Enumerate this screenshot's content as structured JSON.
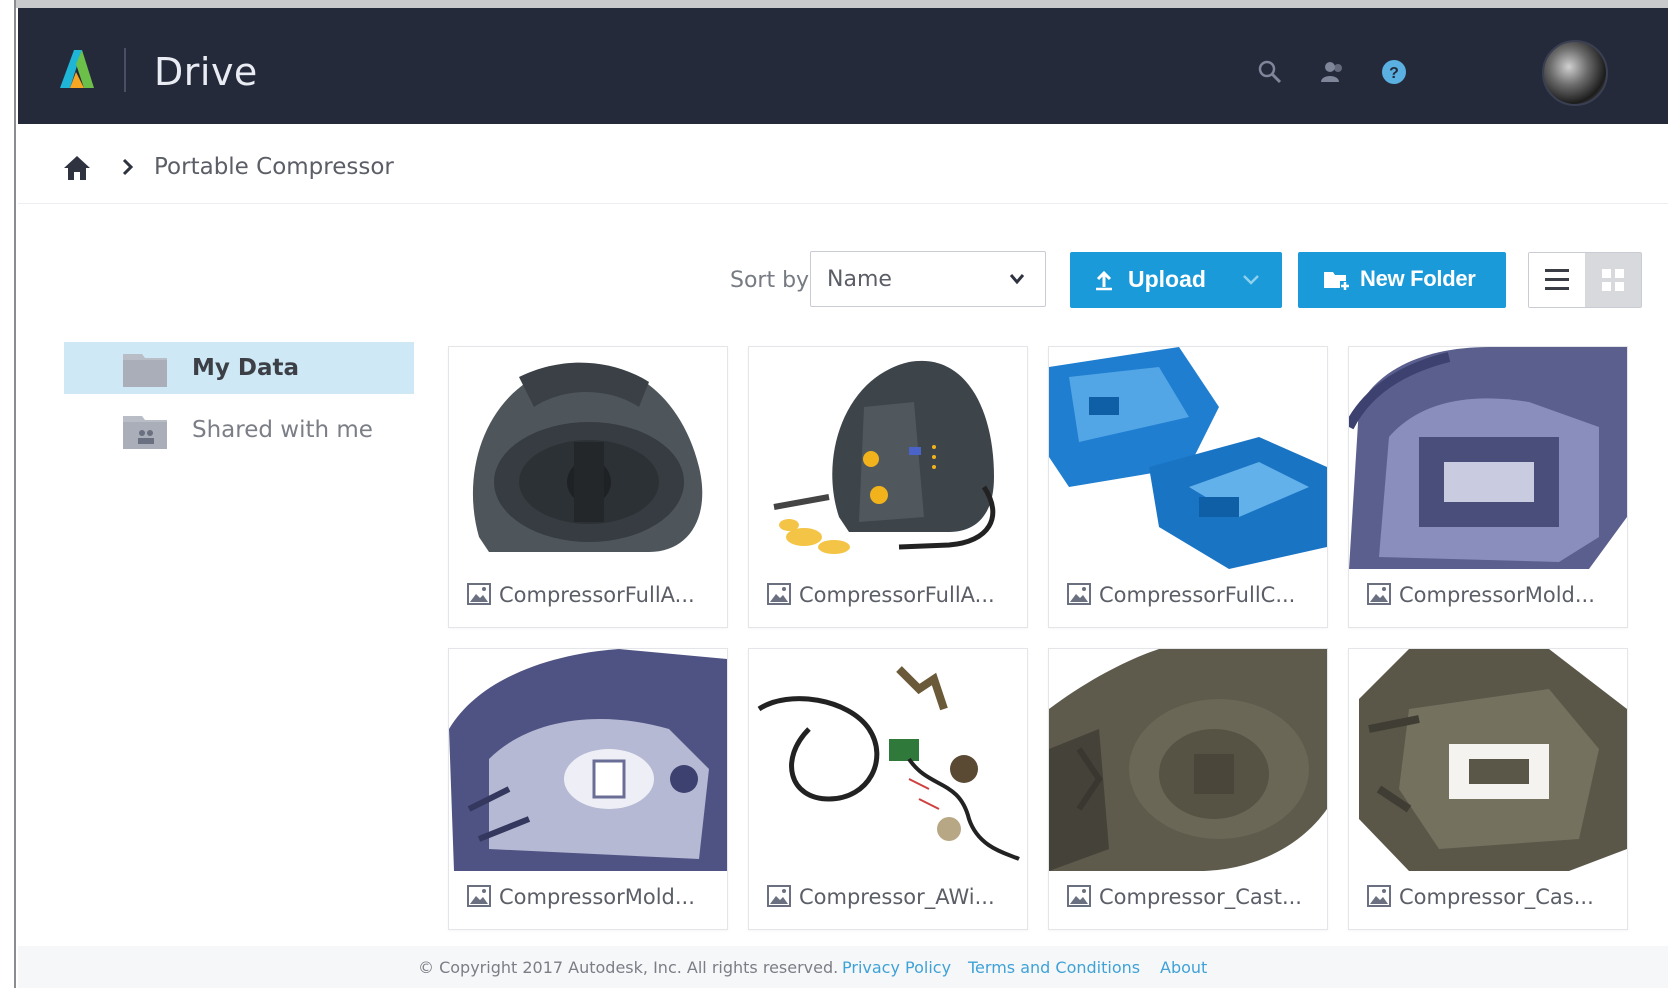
{
  "header": {
    "app_title": "Drive",
    "icons": [
      "autodesk-logo",
      "search-icon",
      "people-icon",
      "help-icon",
      "user-avatar"
    ],
    "colors": {
      "background": "#252a3b",
      "accent": "#1a9ad8"
    }
  },
  "breadcrumb": {
    "items": [
      "Portable Compressor"
    ]
  },
  "toolbar": {
    "sort_label": "Sort by",
    "sort_value": "Name",
    "upload_label": "Upload",
    "new_folder_label": "New Folder",
    "view_mode": "grid"
  },
  "sidebar": {
    "items": [
      {
        "label": "My Data",
        "active": true
      },
      {
        "label": "Shared with me",
        "active": false
      }
    ]
  },
  "files": [
    {
      "name": "CompressorFullA...",
      "thumb": "compressor-dark-side"
    },
    {
      "name": "CompressorFullA...",
      "thumb": "compressor-with-accessories"
    },
    {
      "name": "CompressorFullC...",
      "thumb": "blue-cad-parts"
    },
    {
      "name": "CompressorMold...",
      "thumb": "purple-mold-housing"
    },
    {
      "name": "CompressorMold...",
      "thumb": "blue-mold-interior"
    },
    {
      "name": "Compressor_AWi...",
      "thumb": "wiring-harness"
    },
    {
      "name": "Compressor_Cast...",
      "thumb": "cast-housing-front"
    },
    {
      "name": "Compressor_Cas...",
      "thumb": "cast-housing-interior"
    }
  ],
  "footer": {
    "copyright": "© Copyright 2017 Autodesk, Inc. All rights reserved.",
    "links": [
      "Privacy Policy",
      "Terms and Conditions",
      "About"
    ]
  }
}
